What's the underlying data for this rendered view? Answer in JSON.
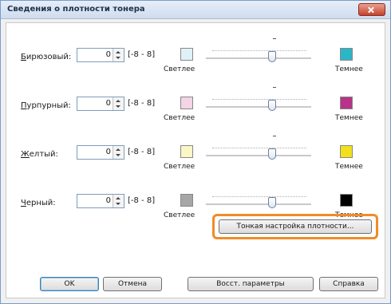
{
  "window": {
    "title": "Сведения о плотности тонера"
  },
  "range_text": "[-8 - 8]",
  "light_label": "Светлее",
  "dark_label": "Темнее",
  "rows": [
    {
      "label": "Бирюзовый:",
      "value": "0",
      "level": 0,
      "light_color": "#dff2f7",
      "dark_color": "#2bb6c8"
    },
    {
      "label": "Пурпурный:",
      "value": "0",
      "level": 0,
      "light_color": "#f4d4e6",
      "dark_color": "#b73488"
    },
    {
      "label": "Желтый:",
      "value": "0",
      "level": 0,
      "light_color": "#fbf6c6",
      "dark_color": "#f0e11c"
    },
    {
      "label": "Черный:",
      "value": "0",
      "level": 0,
      "light_color": "#a6a6a6",
      "dark_color": "#000000"
    }
  ],
  "fine_tune_button": "Тонкая настройка плотности...",
  "buttons": {
    "ok": "OK",
    "cancel": "Отмена",
    "restore": "Восст. параметры",
    "help": "Справка"
  },
  "highlight_color": "#f08c28"
}
